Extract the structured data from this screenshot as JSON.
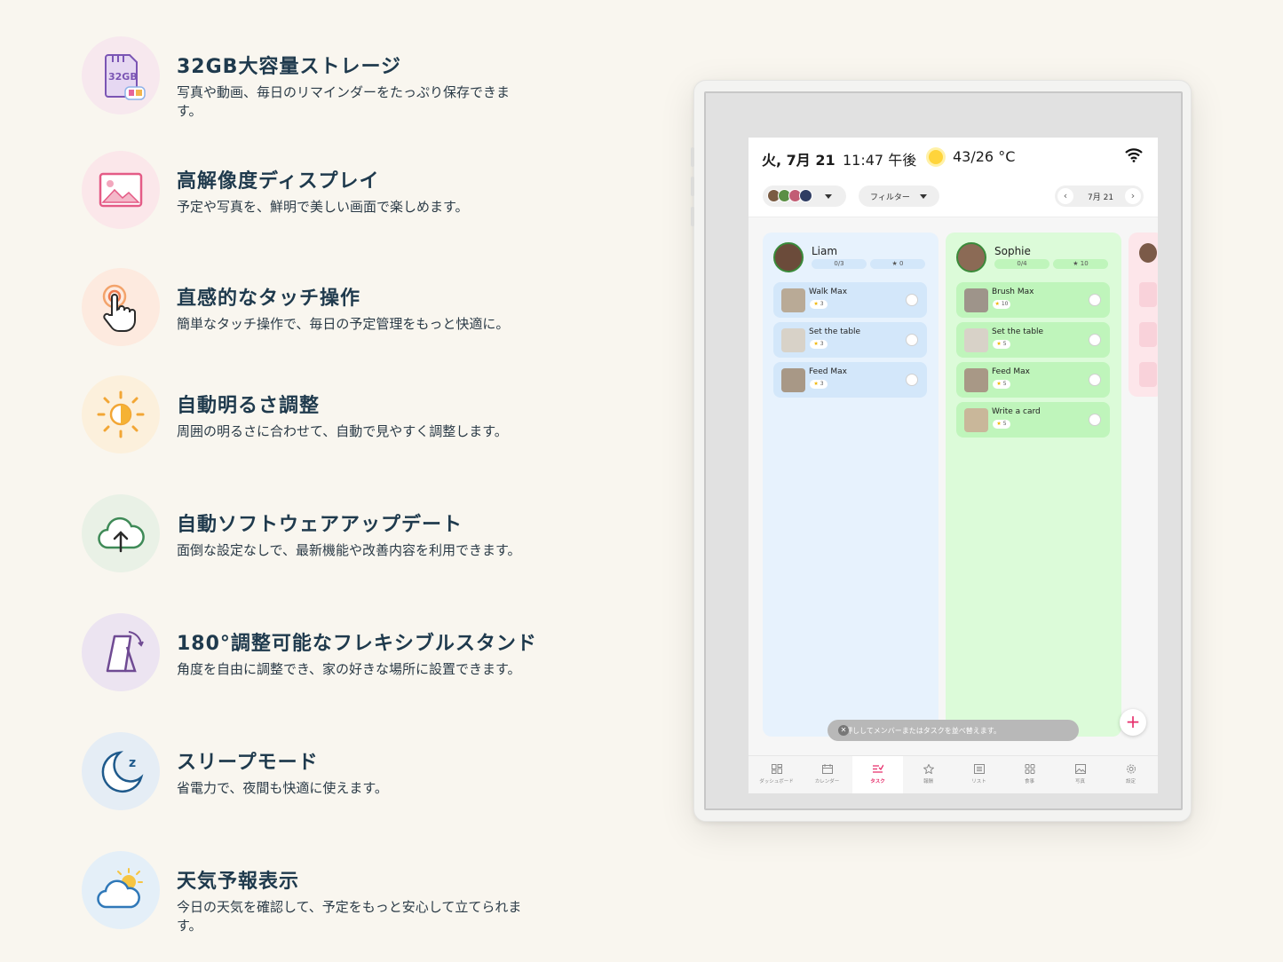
{
  "features": [
    {
      "icon": "sd-card-icon",
      "title": "32GB大容量ストレージ",
      "desc": "写真や動画、毎日のリマインダーをたっぷり保存できます。",
      "badge": "32GB"
    },
    {
      "icon": "image-icon",
      "title": "高解像度ディスプレイ",
      "desc": "予定や写真を、鮮明で美しい画面で楽しめます。"
    },
    {
      "icon": "touch-hand-icon",
      "title": "直感的なタッチ操作",
      "desc": "簡単なタッチ操作で、毎日の予定管理をもっと快適に。"
    },
    {
      "icon": "brightness-icon",
      "title": "自動明るさ調整",
      "desc": "周囲の明るさに合わせて、自動で見やすく調整します。"
    },
    {
      "icon": "cloud-upload-icon",
      "title": "自動ソフトウェアアップデート",
      "desc": "面倒な設定なしで、最新機能や改善内容を利用できます。"
    },
    {
      "icon": "stand-icon",
      "title": "180°調整可能なフレキシブルスタンド",
      "desc": "角度を自由に調整でき、家の好きな場所に設置できます。"
    },
    {
      "icon": "moon-sleep-icon",
      "title": "スリープモード",
      "desc": "省電力で、夜間も快適に使えます。"
    },
    {
      "icon": "weather-icon",
      "title": "天気予報表示",
      "desc": "今日の天気を確認して、予定をもっと安心して立てられます。"
    }
  ],
  "device": {
    "status": {
      "date": "火, 7月 21",
      "time": "11:47 午後",
      "temp": "43/26 °C"
    },
    "toolbar": {
      "filter": "フィルター",
      "nav_date": "7月 21",
      "prev": "‹",
      "next": "›"
    },
    "columns": [
      {
        "name": "Liam",
        "count": "0/3",
        "stars": "0",
        "bg": "#e7f2fd",
        "chip": "#d3e7fa",
        "tasks": [
          {
            "name": "Walk Max",
            "pts": "3"
          },
          {
            "name": "Set the table",
            "pts": "3"
          },
          {
            "name": "Feed Max",
            "pts": "3"
          }
        ]
      },
      {
        "name": "Sophie",
        "count": "0/4",
        "stars": "10",
        "bg": "#dcfbd9",
        "chip": "#bff5bb",
        "tasks": [
          {
            "name": "Brush Max",
            "pts": "10"
          },
          {
            "name": "Set the table",
            "pts": "5"
          },
          {
            "name": "Feed Max",
            "pts": "5"
          },
          {
            "name": "Write a card",
            "pts": "5"
          }
        ]
      }
    ],
    "toast": "長押ししてメンバーまたはタスクを並べ替えます。",
    "toast_close": "✕",
    "fab": "+",
    "nav": [
      "ダッシュボード",
      "カレンダー",
      "タスク",
      "報酬",
      "リスト",
      "食事",
      "写真",
      "設定"
    ],
    "nav_active": "タスク"
  }
}
